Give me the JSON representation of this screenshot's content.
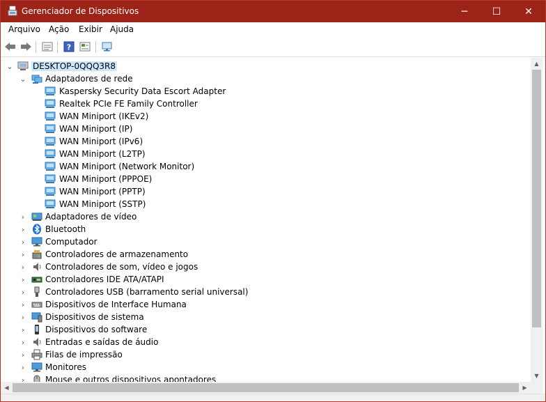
{
  "window": {
    "title": "Gerenciador de Dispositivos",
    "minimize_glyph": "─",
    "maximize_glyph": "☐",
    "close_glyph": "✕"
  },
  "menu": [
    {
      "label": "Arquivo"
    },
    {
      "label": "Ação"
    },
    {
      "label": "Exibir"
    },
    {
      "label": "Ajuda"
    }
  ],
  "toolbar": {
    "buttons": [
      "back-icon",
      "forward-icon",
      "properties-icon",
      "help-icon",
      "update-driver-icon",
      "scan-hardware-icon"
    ]
  },
  "tree": {
    "root": {
      "label": "DESKTOP-0QQQ3R8",
      "icon": "computer-icon",
      "expanded": true
    },
    "network_adapters": {
      "label": "Adaptadores de rede",
      "icon": "network-icon",
      "expanded": true,
      "children": [
        {
          "label": "Kaspersky Security Data Escort Adapter"
        },
        {
          "label": "Realtek PCIe FE Family Controller"
        },
        {
          "label": "WAN Miniport (IKEv2)"
        },
        {
          "label": "WAN Miniport (IP)"
        },
        {
          "label": "WAN Miniport (IPv6)"
        },
        {
          "label": "WAN Miniport (L2TP)"
        },
        {
          "label": "WAN Miniport (Network Monitor)"
        },
        {
          "label": "WAN Miniport (PPPOE)"
        },
        {
          "label": "WAN Miniport (PPTP)"
        },
        {
          "label": "WAN Miniport (SSTP)"
        }
      ]
    },
    "categories": [
      {
        "label": "Adaptadores de vídeo",
        "icon": "display-adapter-icon"
      },
      {
        "label": "Bluetooth",
        "icon": "bluetooth-icon"
      },
      {
        "label": "Computador",
        "icon": "monitor-icon"
      },
      {
        "label": "Controladores de armazenamento",
        "icon": "storage-controller-icon"
      },
      {
        "label": "Controladores de som, vídeo e jogos",
        "icon": "speaker-icon"
      },
      {
        "label": "Controladores IDE ATA/ATAPI",
        "icon": "ide-controller-icon"
      },
      {
        "label": "Controladores USB (barramento serial universal)",
        "icon": "usb-icon"
      },
      {
        "label": "Dispositivos de Interface Humana",
        "icon": "hid-icon"
      },
      {
        "label": "Dispositivos de sistema",
        "icon": "system-device-icon"
      },
      {
        "label": "Dispositivos do software",
        "icon": "software-device-icon"
      },
      {
        "label": "Entradas e saídas de áudio",
        "icon": "audio-io-icon"
      },
      {
        "label": "Filas de impressão",
        "icon": "printer-icon"
      },
      {
        "label": "Monitores",
        "icon": "monitor-icon"
      },
      {
        "label": "Mouse e outros dispositivos apontadores",
        "icon": "mouse-icon"
      }
    ]
  },
  "colors": {
    "titlebar": "#9c2318",
    "selection": "#cce8ff",
    "network_icon": "#2f8fd6"
  }
}
